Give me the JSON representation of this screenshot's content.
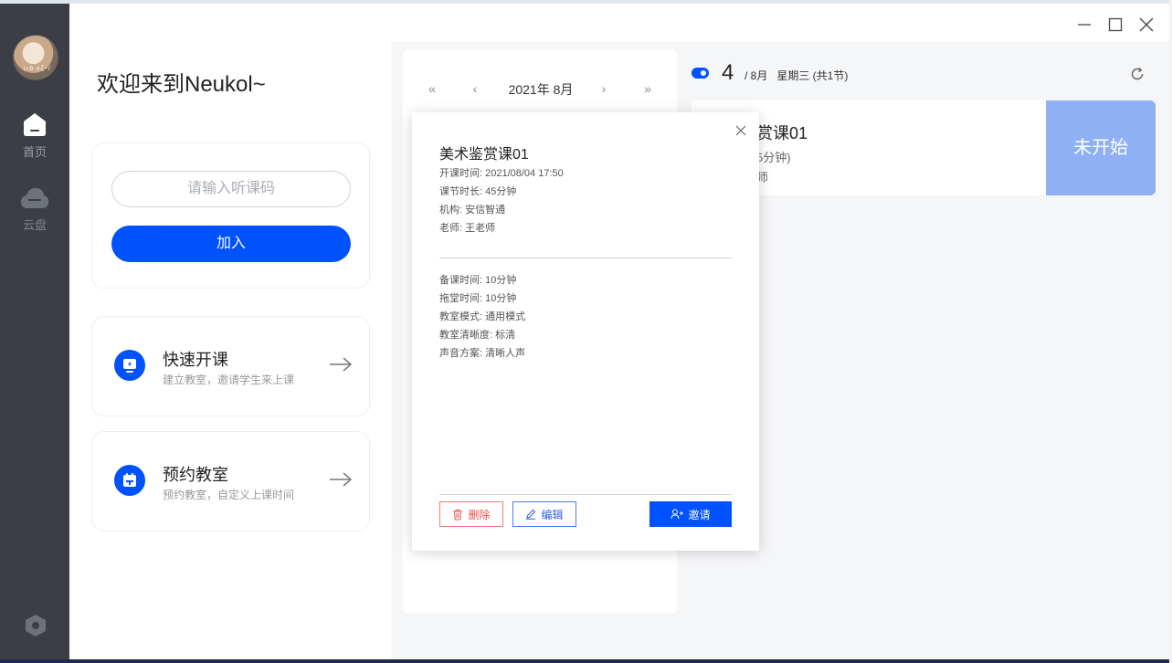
{
  "sidebar": {
    "avatar_text": "ぃö ∧ζ~/",
    "items": [
      {
        "label": "首页",
        "icon": "home-icon"
      },
      {
        "label": "云盘",
        "icon": "cloud-icon"
      }
    ],
    "settings_icon": "settings-icon"
  },
  "window_controls": [
    "minimize-icon",
    "maximize-icon",
    "close-icon"
  ],
  "welcome": {
    "title": "欢迎来到Neukol~"
  },
  "join": {
    "placeholder": "请输入听课码",
    "button_label": "加入"
  },
  "quick_start": {
    "title": "快速开课",
    "subtitle": "建立教室，邀请学生来上课",
    "icon": "quick-class-icon"
  },
  "reserve": {
    "title": "预约教室",
    "subtitle": "预约教室，自定义上课时间",
    "icon": "calendar-icon"
  },
  "calendar": {
    "title": "2021年 8月",
    "nav": [
      "«",
      "‹",
      "›",
      "»"
    ]
  },
  "day": {
    "number": "4",
    "month": "/ 8月",
    "weekday": "星期三 (共1节)"
  },
  "course_card": {
    "name_partial": "赏课01",
    "duration_partial": "5分钟)",
    "teacher_partial": "师",
    "status": "未开始"
  },
  "popup": {
    "title": "美术鉴赏课01",
    "info": [
      "开课时间: 2021/08/04 17:50",
      "课节时长: 45分钟",
      "机构: 安信智通",
      "老师: 王老师"
    ],
    "settings": [
      "备课时间: 10分钟",
      "拖堂时间: 10分钟",
      "教室模式: 通用模式",
      "教室清晰度: 标清",
      "声音方案: 清晰人声"
    ],
    "delete_label": "删除",
    "edit_label": "编辑",
    "invite_label": "邀请"
  },
  "colors": {
    "accent": "#0052ff",
    "sidebar": "#3b3e44",
    "status_bg": "#8fb0f5",
    "danger": "#f05050"
  }
}
